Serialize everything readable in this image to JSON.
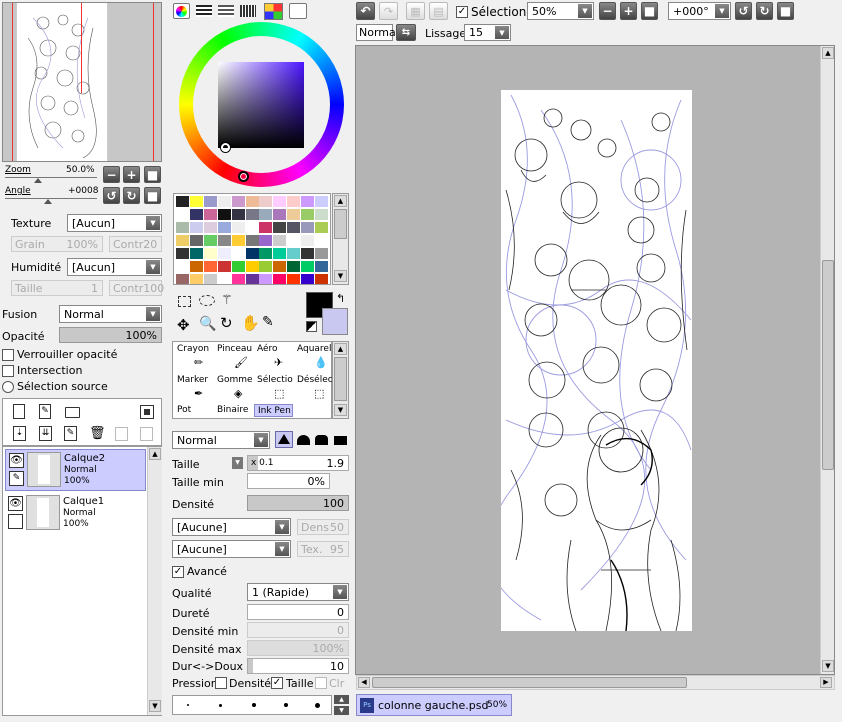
{
  "navigator": {
    "zoom_label": "Zoom",
    "zoom_value": "50.0%",
    "angle_label": "Angle",
    "angle_value": "+0008"
  },
  "texture": {
    "texture_label": "Texture",
    "texture_value": "[Aucun]",
    "grain_label": "Grain",
    "grain_value": "100%",
    "contr1_label": "Contr",
    "contr1_value": "20",
    "humidity_label": "Humidité",
    "humidity_value": "[Aucun]",
    "size_label": "Taille",
    "size_value": "1",
    "contr2_label": "Contr",
    "contr2_value": "100"
  },
  "layer_props": {
    "fusion_label": "Fusion",
    "fusion_value": "Normal",
    "opacity_label": "Opacité",
    "opacity_value": "100%",
    "lock_opacity": "Verrouiller opacité",
    "intersection": "Intersection",
    "selection_source": "Sélection source"
  },
  "layers": [
    {
      "name": "Calque2",
      "mode": "Normal",
      "opacity": "100%"
    },
    {
      "name": "Calque1",
      "mode": "Normal",
      "opacity": "100%"
    }
  ],
  "tools": {
    "row1": [
      "Crayon",
      "Pinceau",
      "Aéro",
      "Aquarell"
    ],
    "row2": [
      "Marker",
      "Gomme",
      "Sélectior",
      "Désélect"
    ],
    "row3": [
      "Pot",
      "Binaire",
      "Ink Pen"
    ]
  },
  "brush": {
    "mode_value": "Normal",
    "size_label": "Taille",
    "size_mult": "x 0.1",
    "size_value": "1.9",
    "min_size_label": "Taille min",
    "min_size_value": "0%",
    "density_label": "Densité",
    "density_value": "100",
    "shape1_value": "[Aucune]",
    "shape1_param_label": "Dens",
    "shape1_param_value": "50",
    "shape2_value": "[Aucune]",
    "shape2_param_label": "Tex.",
    "shape2_param_value": "95",
    "advanced_label": "Avancé",
    "quality_label": "Qualité",
    "quality_value": "1 (Rapide)",
    "hardness_label": "Dureté",
    "hardness_value": "0",
    "min_density_label": "Densité min",
    "min_density_value": "0",
    "max_density_label": "Densité max",
    "max_density_value": "100%",
    "hard_soft_label": "Dur<->Doux",
    "hard_soft_value": "10",
    "pressure_label": "Pression",
    "pressure_density_label": "Densité",
    "pressure_size_label": "Taille",
    "pressure_clr_label": "Clr"
  },
  "toolbar": {
    "selection_label": "Sélection",
    "zoom_value": "50%",
    "rotation_value": "+000°",
    "blend_value": "Normal",
    "smoothing_label": "Lissage",
    "smoothing_value": "15"
  },
  "status": {
    "file_name": "colonne gauche.psd",
    "zoom": "50%",
    "file_badge": "Ps"
  },
  "colors": {
    "primary": "#000000",
    "secondary": "#c8c8f0",
    "accent": "#ccccff"
  }
}
